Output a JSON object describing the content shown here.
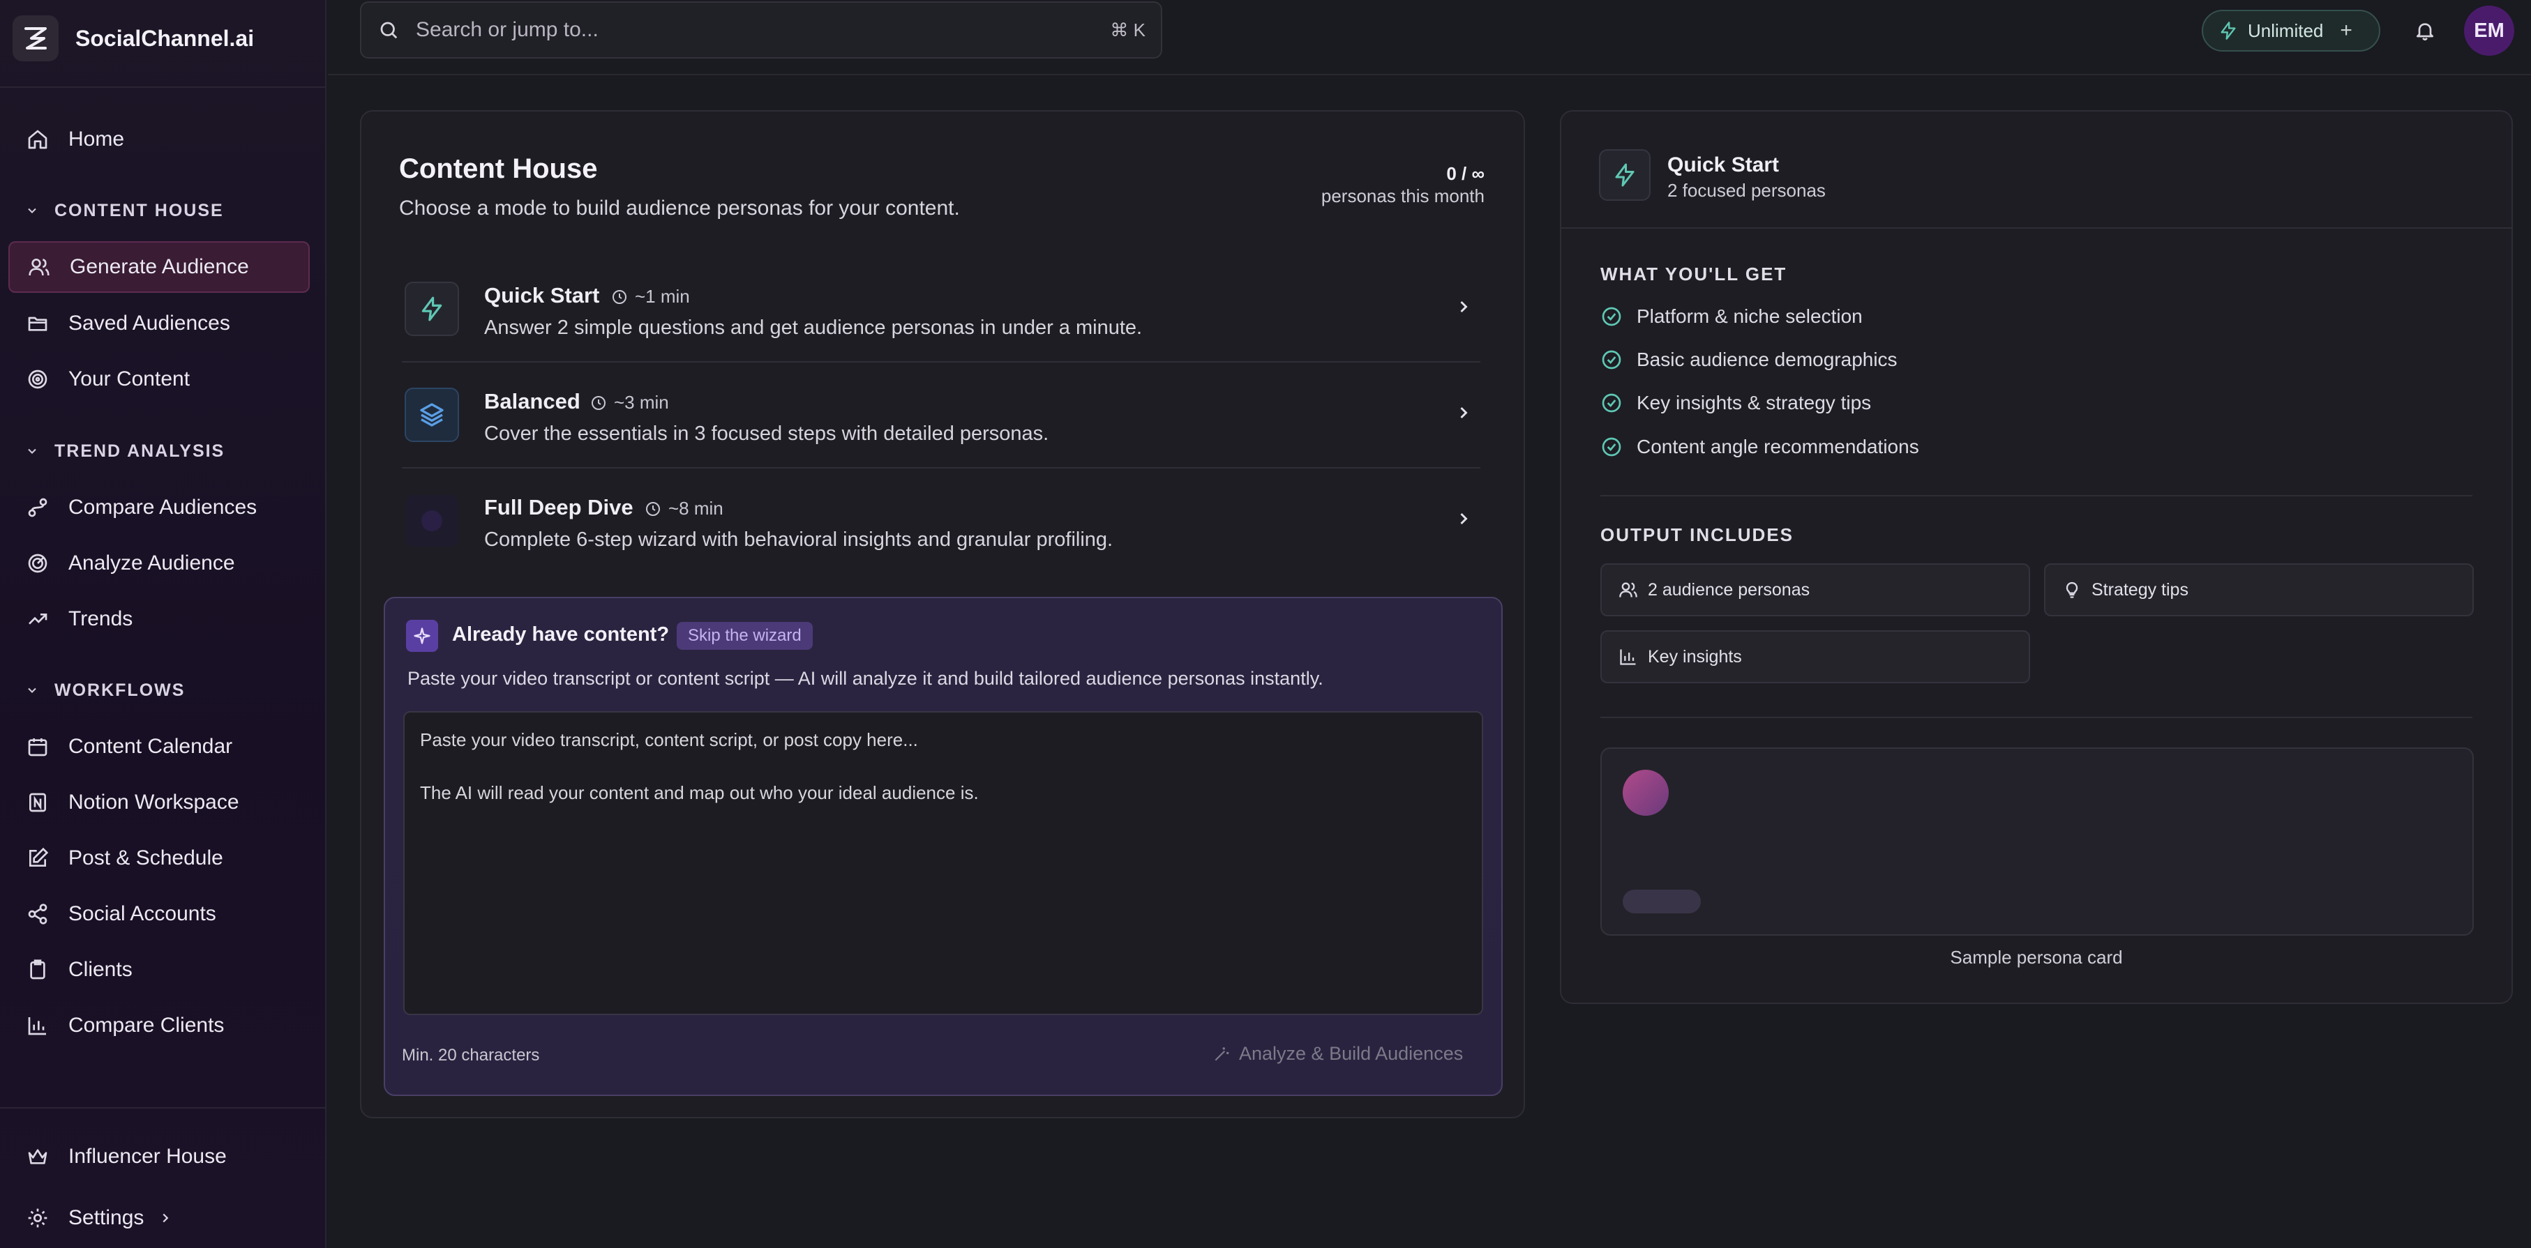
{
  "app": {
    "name": "SocialChannel.ai"
  },
  "sidebar": {
    "home": "Home",
    "sections": [
      {
        "title": "CONTENT HOUSE",
        "items": [
          "Generate Audience",
          "Saved Audiences",
          "Your Content"
        ]
      },
      {
        "title": "TREND ANALYSIS",
        "items": [
          "Compare Audiences",
          "Analyze Audience",
          "Trends"
        ]
      },
      {
        "title": "WORKFLOWS",
        "items": [
          "Content Calendar",
          "Notion Workspace",
          "Post & Schedule",
          "Social Accounts",
          "Clients",
          "Compare Clients"
        ]
      }
    ],
    "bottom": {
      "influencer": "Influencer House",
      "settings": "Settings"
    }
  },
  "topbar": {
    "search_placeholder": "Search or jump to...",
    "shortcut": "⌘ K",
    "plan_label": "Unlimited",
    "plan_action": "+",
    "user_initials": "EM"
  },
  "content_house": {
    "title": "Content House",
    "subtitle": "Choose a mode to build audience personas for your content.",
    "usage": "0 / ∞",
    "usage_label": "personas this month",
    "modes": [
      {
        "name": "Quick Start",
        "time": "~1 min",
        "desc": "Answer 2 simple questions and get audience personas in under a minute.",
        "icon": "lightning-icon"
      },
      {
        "name": "Balanced",
        "time": "~3 min",
        "desc": "Cover the essentials in 3 focused steps with detailed personas.",
        "icon": "layers-icon"
      },
      {
        "name": "Full Deep Dive",
        "time": "~8 min",
        "desc": "Complete 6-step wizard with behavioral insights and granular profiling.",
        "icon": "target-icon"
      }
    ]
  },
  "paste": {
    "title": "Already have content?",
    "skip_label": "Skip the wizard",
    "description": "Paste your video transcript or content script — AI will analyze it and build tailored audience personas instantly.",
    "placeholder_line1": "Paste your video transcript, content script, or post copy here...",
    "placeholder_line2": "The AI will read your content and map out who your ideal audience is.",
    "min_chars": "Min. 20 characters",
    "analyze_label": "Analyze & Build Audiences"
  },
  "preview": {
    "title": "Quick Start",
    "subtitle": "2 focused personas",
    "what_heading": "WHAT YOU'LL GET",
    "features": [
      "Platform & niche selection",
      "Basic audience demographics",
      "Key insights & strategy tips",
      "Content angle recommendations"
    ],
    "output_heading": "OUTPUT INCLUDES",
    "outputs": [
      "2 audience personas",
      "Strategy tips",
      "Key insights"
    ],
    "sample_caption": "Sample persona card"
  },
  "colors": {
    "accent_teal": "#5fc8b4",
    "accent_purple": "#7b5cd6",
    "brand_magenta": "#5d2b50"
  }
}
